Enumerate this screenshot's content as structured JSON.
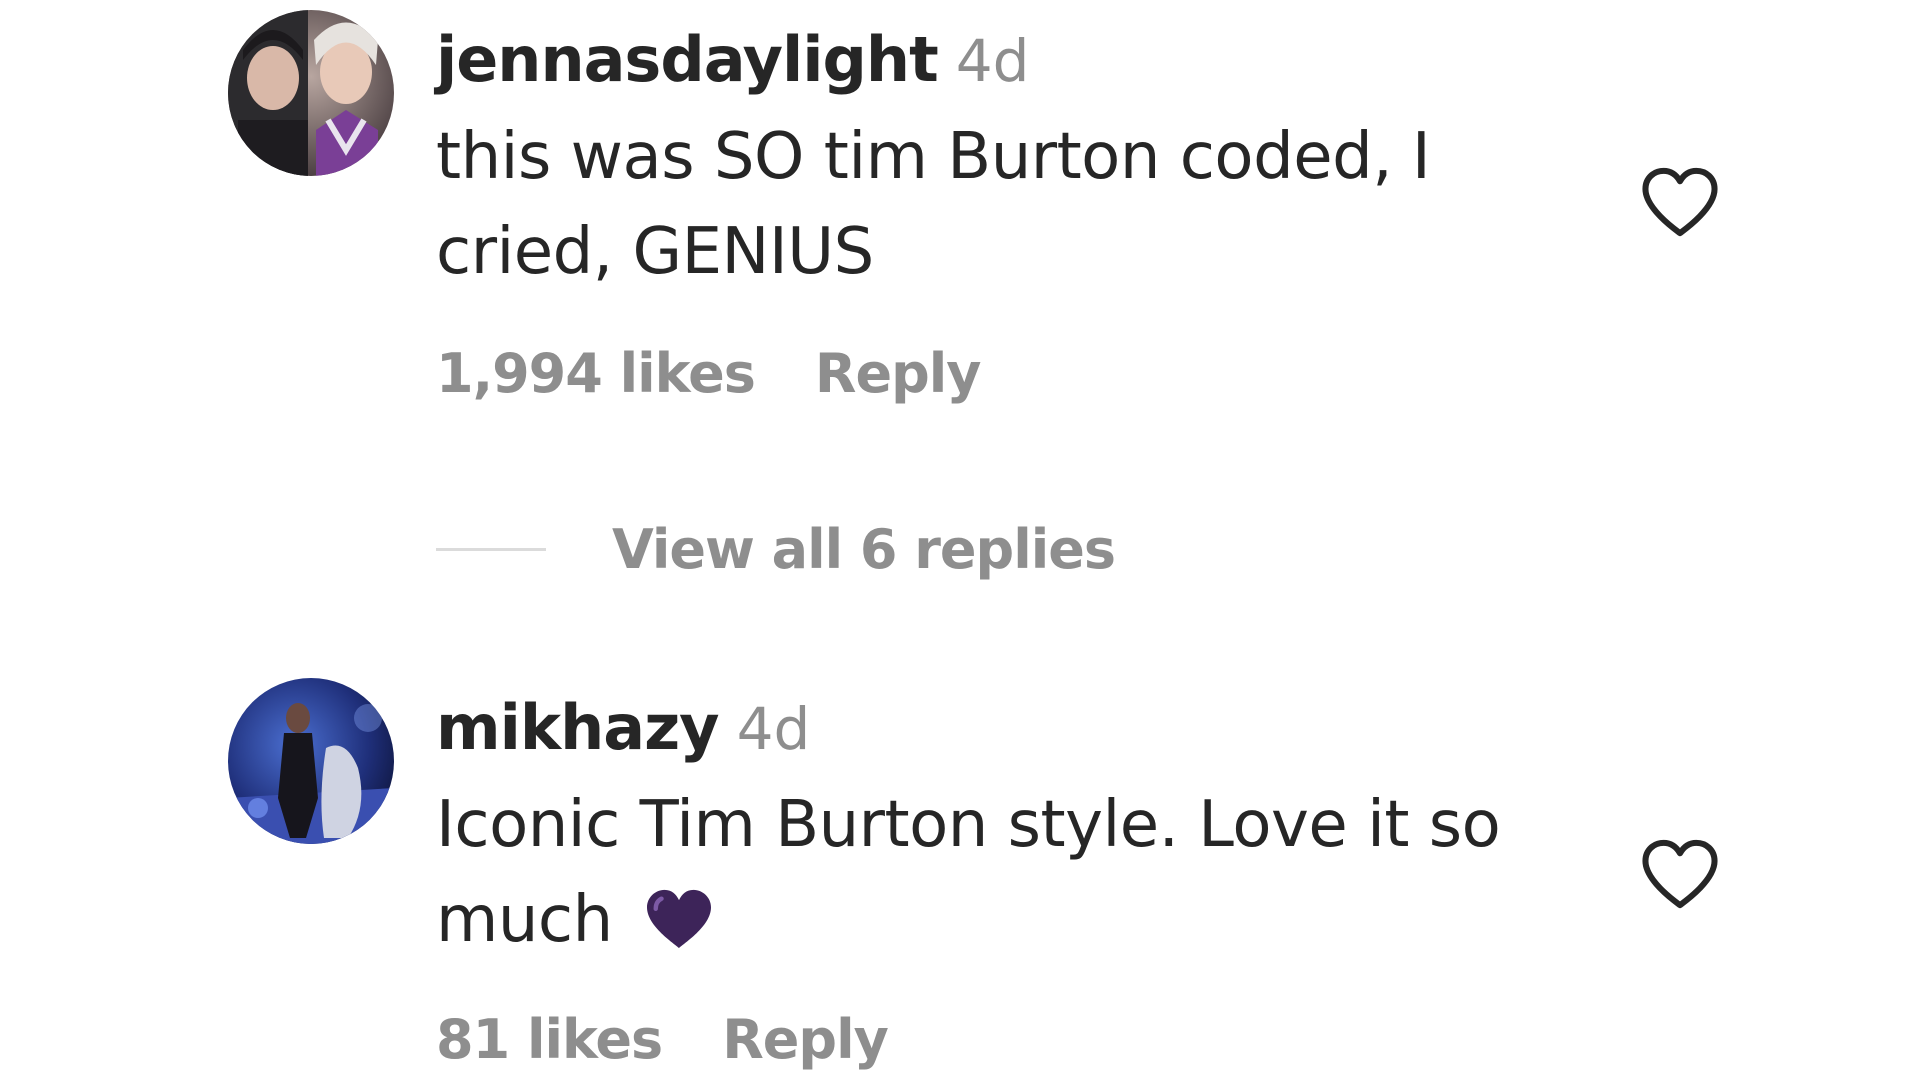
{
  "comments": [
    {
      "username": "jennasdaylight",
      "timestamp": "4d",
      "text": "this was SO tim Burton coded, I cried, GENIUS",
      "likes": "1,994 likes",
      "reply_label": "Reply",
      "avatar_icon": "profile-photo-two-people"
    },
    {
      "username": "mikhazy",
      "timestamp": "4d",
      "text": "Iconic Tim Burton style. Love it so much",
      "emoji": "purple-heart",
      "likes": "81 likes",
      "reply_label": "Reply",
      "avatar_icon": "profile-photo-stage"
    }
  ],
  "view_replies": {
    "label": "View all 6 replies"
  },
  "icons": {
    "like": "heart-outline-icon"
  },
  "colors": {
    "text_primary": "#262626",
    "text_secondary": "#8e8e8e",
    "divider": "#dbdbdb",
    "emoji_heart": "#4b2a6b"
  }
}
